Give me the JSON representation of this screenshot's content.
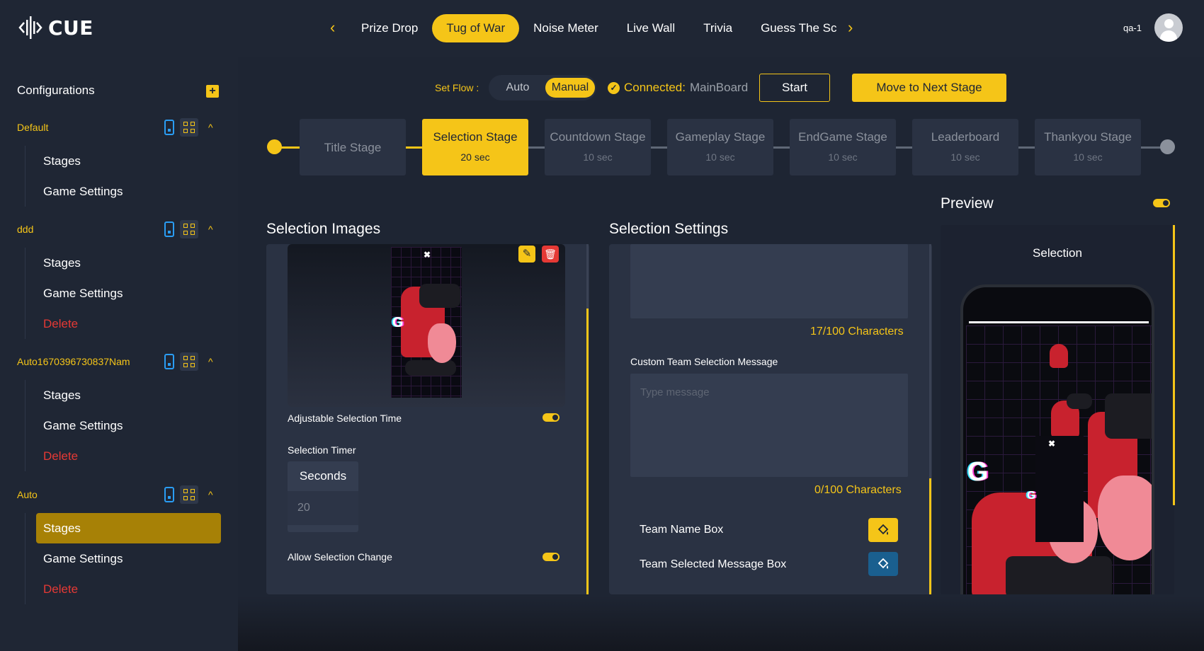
{
  "app": {
    "logo_text": "CUE"
  },
  "nav": {
    "tabs": [
      {
        "label": "Prize Drop",
        "active": false
      },
      {
        "label": "Tug of War",
        "active": true
      },
      {
        "label": "Noise Meter",
        "active": false
      },
      {
        "label": "Live Wall",
        "active": false
      },
      {
        "label": "Trivia",
        "active": false
      },
      {
        "label": "Guess The Sc",
        "active": false
      }
    ],
    "prev_icon": "chevron-left-icon",
    "next_icon": "chevron-right-icon"
  },
  "user": {
    "name": "qa-1"
  },
  "sidebar": {
    "title": "Configurations",
    "groups": [
      {
        "name": "Default",
        "items": [
          "Stages",
          "Game Settings"
        ]
      },
      {
        "name": "ddd",
        "items": [
          "Stages",
          "Game Settings",
          "Delete"
        ]
      },
      {
        "name": "Auto1670396730837Nam",
        "items": [
          "Stages",
          "Game Settings",
          "Delete"
        ]
      },
      {
        "name": "Auto",
        "items": [
          "Stages",
          "Game Settings",
          "Delete"
        ],
        "active_item": "Stages"
      }
    ]
  },
  "flow": {
    "label": "Set Flow :",
    "options": [
      "Auto",
      "Manual"
    ],
    "selected": "Manual",
    "connected_label": "Connected:",
    "connected_value": "MainBoard",
    "start_label": "Start",
    "next_label": "Move to Next Stage"
  },
  "stages": [
    {
      "name": "Title Stage",
      "time": ""
    },
    {
      "name": "Selection Stage",
      "time": "20 sec",
      "active": true
    },
    {
      "name": "Countdown Stage",
      "time": "10 sec"
    },
    {
      "name": "Gameplay Stage",
      "time": "10 sec"
    },
    {
      "name": "EndGame Stage",
      "time": "10 sec"
    },
    {
      "name": "Leaderboard",
      "time": "10 sec"
    },
    {
      "name": "Thankyou Stage",
      "time": "10 sec"
    }
  ],
  "selection_images": {
    "title": "Selection Images",
    "adjustable_label": "Adjustable Selection Time",
    "adjustable_on": true,
    "timer_label": "Selection Timer",
    "timer_unit": "Seconds",
    "timer_value": "20",
    "allow_change_label": "Allow Selection Change",
    "allow_change_on": true
  },
  "selection_settings": {
    "title": "Selection Settings",
    "counter1": "17/100 Characters",
    "custom_msg_label": "Custom Team Selection Message",
    "custom_msg_placeholder": "Type message",
    "counter2": "0/100 Characters",
    "team_name_label": "Team Name Box",
    "team_selected_label": "Team Selected Message Box",
    "team_name_color": "#f5c518",
    "team_selected_color": "#1a5f8f"
  },
  "preview": {
    "title": "Preview",
    "enabled": true,
    "subtitle": "Selection"
  },
  "colors": {
    "accent": "#f5c518",
    "danger": "#e53935",
    "bg": "#1f2634",
    "panel": "#2a3243"
  }
}
